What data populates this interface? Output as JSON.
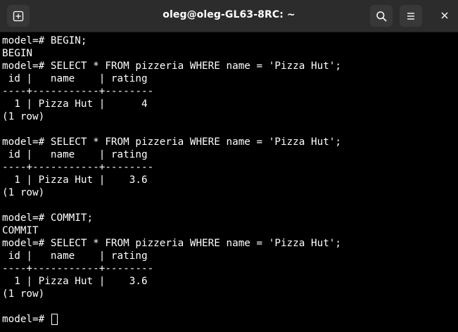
{
  "window": {
    "title": "oleg@oleg-GL63-8RC: ~"
  },
  "toolbar": {
    "new_tab_icon": "new-tab-icon",
    "search_icon": "search-icon",
    "menu_icon": "hamburger-menu-icon",
    "close_icon": "close-icon"
  },
  "terminal": {
    "lines": [
      "model=# BEGIN;",
      "BEGIN",
      "model=# SELECT * FROM pizzeria WHERE name = 'Pizza Hut';",
      " id |   name    | rating",
      "----+-----------+--------",
      "  1 | Pizza Hut |      4",
      "(1 row)",
      "",
      "model=# SELECT * FROM pizzeria WHERE name = 'Pizza Hut';",
      " id |   name    | rating",
      "----+-----------+--------",
      "  1 | Pizza Hut |    3.6",
      "(1 row)",
      "",
      "model=# COMMIT;",
      "COMMIT",
      "model=# SELECT * FROM pizzeria WHERE name = 'Pizza Hut';",
      " id |   name    | rating",
      "----+-----------+--------",
      "  1 | Pizza Hut |    3.6",
      "(1 row)",
      ""
    ],
    "prompt": "model=# "
  },
  "colors": {
    "background": "#000000",
    "titlebar": "#2c2c2c",
    "text": "#ffffff"
  }
}
